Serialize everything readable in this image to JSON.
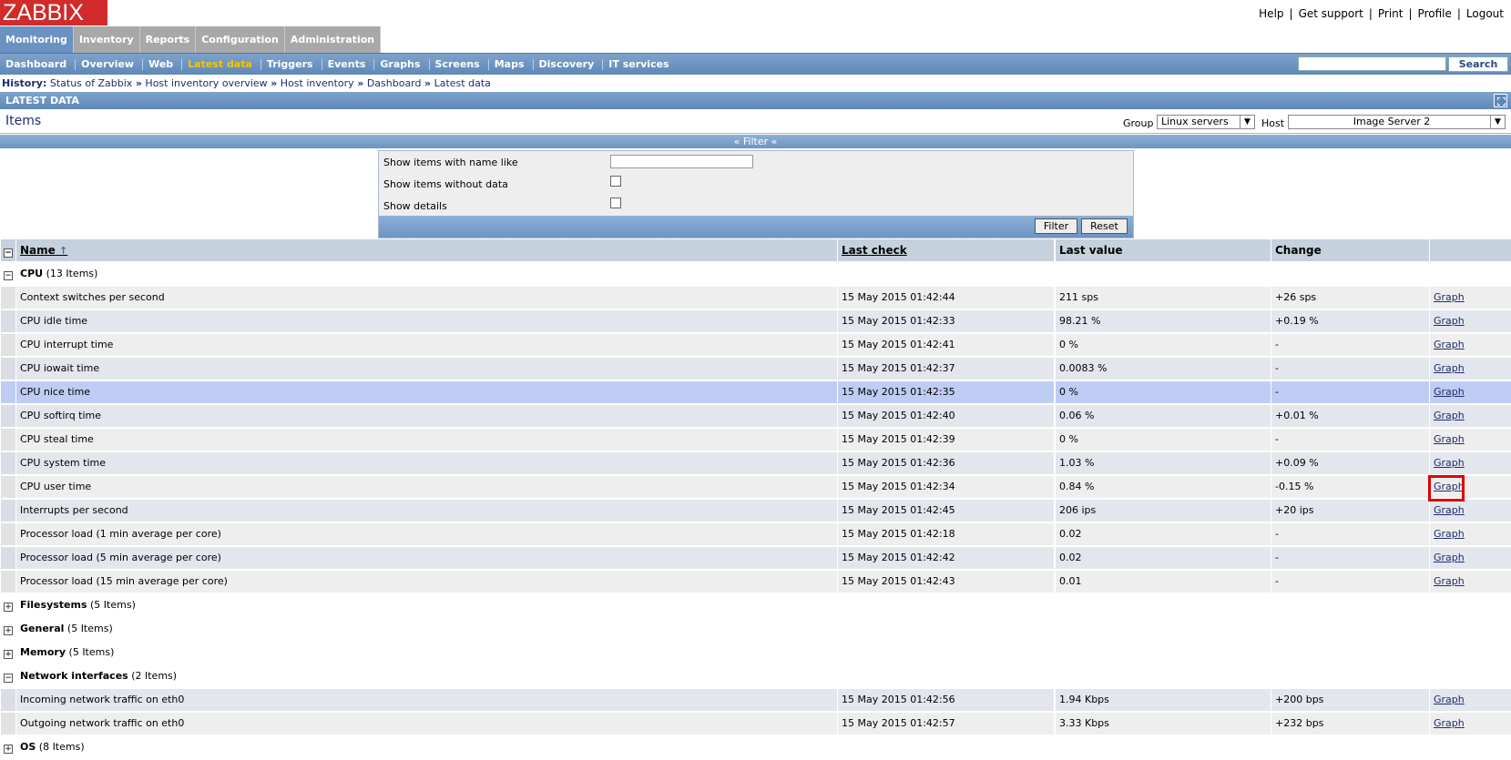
{
  "logo": "ZABBIX",
  "toplinks": [
    "Help",
    "Get support",
    "Print",
    "Profile",
    "Logout"
  ],
  "mainmenu": [
    {
      "label": "Monitoring",
      "active": true
    },
    {
      "label": "Inventory",
      "active": false
    },
    {
      "label": "Reports",
      "active": false
    },
    {
      "label": "Configuration",
      "active": false
    },
    {
      "label": "Administration",
      "active": false
    }
  ],
  "submenu": [
    "Dashboard",
    "Overview",
    "Web",
    "Latest data",
    "Triggers",
    "Events",
    "Graphs",
    "Screens",
    "Maps",
    "Discovery",
    "IT services"
  ],
  "submenu_active": "Latest data",
  "search": {
    "value": "",
    "button": "Search"
  },
  "history": {
    "label": "History:",
    "path": [
      "Status of Zabbix",
      "Host inventory overview",
      "Host inventory",
      "Dashboard",
      "Latest data"
    ],
    "sep": "»"
  },
  "section_title": "LATEST DATA",
  "items_title": "Items",
  "group": {
    "label": "Group",
    "value": "Linux servers"
  },
  "host": {
    "label": "Host",
    "value": "Image Server 2"
  },
  "filter": {
    "toggle_label": "« Filter «",
    "name_like_label": "Show items with name like",
    "name_like_value": "",
    "without_data_label": "Show items without data",
    "details_label": "Show details",
    "filter_button": "Filter",
    "reset_button": "Reset"
  },
  "table": {
    "headers": [
      "Name",
      "Last check",
      "Last value",
      "Change",
      ""
    ],
    "groups": [
      {
        "name": "CPU",
        "count": "(13 Items)",
        "expanded": true,
        "rows": [
          {
            "name": "Context switches per second",
            "last_check": "15 May 2015 01:42:44",
            "last_value": "211 sps",
            "change": "+26 sps",
            "link": "Graph"
          },
          {
            "name": "CPU idle time",
            "last_check": "15 May 2015 01:42:33",
            "last_value": "98.21 %",
            "change": "+0.19 %",
            "link": "Graph"
          },
          {
            "name": "CPU interrupt time",
            "last_check": "15 May 2015 01:42:41",
            "last_value": "0 %",
            "change": "-",
            "link": "Graph"
          },
          {
            "name": "CPU iowait time",
            "last_check": "15 May 2015 01:42:37",
            "last_value": "0.0083 %",
            "change": "-",
            "link": "Graph"
          },
          {
            "name": "CPU nice time",
            "last_check": "15 May 2015 01:42:35",
            "last_value": "0 %",
            "change": "-",
            "link": "Graph"
          },
          {
            "name": "CPU softirq time",
            "last_check": "15 May 2015 01:42:40",
            "last_value": "0.06 %",
            "change": "+0.01 %",
            "link": "Graph"
          },
          {
            "name": "CPU steal time",
            "last_check": "15 May 2015 01:42:39",
            "last_value": "0 %",
            "change": "-",
            "link": "Graph"
          },
          {
            "name": "CPU system time",
            "last_check": "15 May 2015 01:42:36",
            "last_value": "1.03 %",
            "change": "+0.09 %",
            "link": "Graph"
          },
          {
            "name": "CPU user time",
            "last_check": "15 May 2015 01:42:34",
            "last_value": "0.84 %",
            "change": "-0.15 %",
            "link": "Graph"
          },
          {
            "name": "Interrupts per second",
            "last_check": "15 May 2015 01:42:45",
            "last_value": "206 ips",
            "change": "+20 ips",
            "link": "Graph"
          },
          {
            "name": "Processor load (1 min average per core)",
            "last_check": "15 May 2015 01:42:18",
            "last_value": "0.02",
            "change": "-",
            "link": "Graph"
          },
          {
            "name": "Processor load (5 min average per core)",
            "last_check": "15 May 2015 01:42:42",
            "last_value": "0.02",
            "change": "-",
            "link": "Graph"
          },
          {
            "name": "Processor load (15 min average per core)",
            "last_check": "15 May 2015 01:42:43",
            "last_value": "0.01",
            "change": "-",
            "link": "Graph"
          }
        ]
      },
      {
        "name": "Filesystems",
        "count": "(5 Items)",
        "expanded": false,
        "rows": []
      },
      {
        "name": "General",
        "count": "(5 Items)",
        "expanded": false,
        "rows": []
      },
      {
        "name": "Memory",
        "count": "(5 Items)",
        "expanded": false,
        "rows": []
      },
      {
        "name": "Network interfaces",
        "count": "(2 Items)",
        "expanded": true,
        "rows": [
          {
            "name": "Incoming network traffic on eth0",
            "last_check": "15 May 2015 01:42:56",
            "last_value": "1.94 Kbps",
            "change": "+200 bps",
            "link": "Graph"
          },
          {
            "name": "Outgoing network traffic on eth0",
            "last_check": "15 May 2015 01:42:57",
            "last_value": "3.33 Kbps",
            "change": "+232 bps",
            "link": "Graph"
          }
        ]
      },
      {
        "name": "OS",
        "count": "(8 Items)",
        "expanded": false,
        "rows": []
      }
    ]
  },
  "colors": {
    "logo_red": "#d12b2b",
    "menu_active": "#6a93c2",
    "submenu_active_text": "#f5c500",
    "highlight_row": "#bfcdf5",
    "annotation_red": "#e00000"
  }
}
